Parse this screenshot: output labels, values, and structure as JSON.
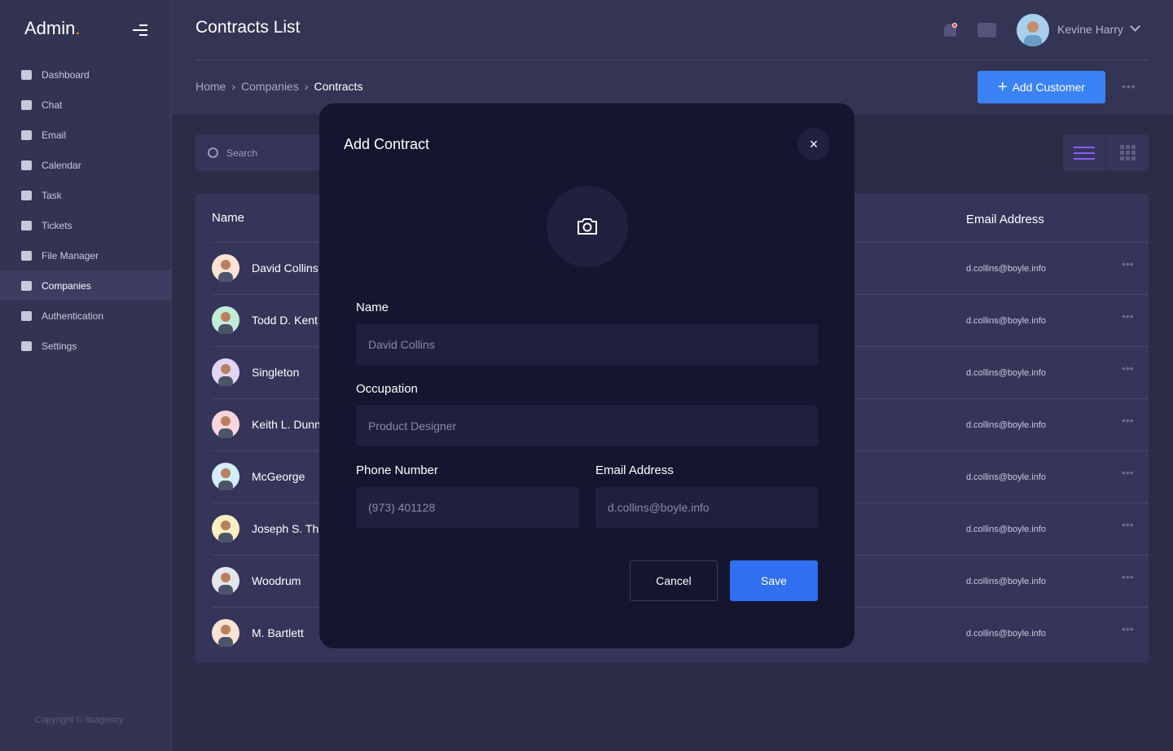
{
  "app": {
    "logo": "Admin",
    "logo_dot": "."
  },
  "sidebar": {
    "items": [
      {
        "label": "Dashboard",
        "icon": "dashboard-icon"
      },
      {
        "label": "Chat",
        "icon": "chat-icon"
      },
      {
        "label": "Email",
        "icon": "email-icon"
      },
      {
        "label": "Calendar",
        "icon": "calendar-icon"
      },
      {
        "label": "Task",
        "icon": "clipboard-icon"
      },
      {
        "label": "Tickets",
        "icon": "ticket-icon"
      },
      {
        "label": "File Manager",
        "icon": "file-icon"
      },
      {
        "label": "Companies",
        "icon": "bar-chart-icon",
        "active": true
      },
      {
        "label": "Authentication",
        "icon": "lock-icon"
      },
      {
        "label": "Settings",
        "icon": "gear-icon"
      }
    ],
    "copyright": "Copyright © itoagency"
  },
  "header": {
    "title": "Contracts List",
    "user": "Kevine Harry",
    "breadcrumb": [
      "Home",
      "Companies",
      "Contracts"
    ],
    "breadcrumb_sep": "›",
    "add_button": "Add Customer",
    "more": "•••"
  },
  "toolbar": {
    "search_placeholder": "Search"
  },
  "table": {
    "columns": {
      "name": "Name",
      "email": "Email Address"
    },
    "rows": [
      {
        "name": "David Collins",
        "email": "d.collins@boyle.info",
        "avatar_color": "#fde2d6"
      },
      {
        "name": "Todd D. Kent",
        "email": "d.collins@boyle.info",
        "avatar_color": "#c3ecd6"
      },
      {
        "name": "Singleton",
        "email": "d.collins@boyle.info",
        "avatar_color": "#e2d4f7"
      },
      {
        "name": "Keith L. Dunn",
        "email": "d.collins@boyle.info",
        "avatar_color": "#f8d5dc"
      },
      {
        "name": "McGeorge",
        "email": "d.collins@boyle.info",
        "avatar_color": "#d4eef8"
      },
      {
        "name": "Joseph S. Th",
        "email": "d.collins@boyle.info",
        "avatar_color": "#fbf0c4"
      },
      {
        "name": "Woodrum",
        "email": "d.collins@boyle.info",
        "avatar_color": "#e4e6ec"
      },
      {
        "name": "M. Bartlett",
        "email": "d.collins@boyle.info",
        "avatar_color": "#fde2d6"
      }
    ]
  },
  "modal": {
    "title": "Add Contract",
    "close": "×",
    "fields": {
      "name_label": "Name",
      "name_value": "David Collins",
      "occupation_label": "Occupation",
      "occupation_value": "Product Designer",
      "phone_label": "Phone Number",
      "phone_value": "(973) 401128",
      "email_label": "Email Address",
      "email_value": "d.collins@boyle.info"
    },
    "cancel": "Cancel",
    "save": "Save"
  }
}
